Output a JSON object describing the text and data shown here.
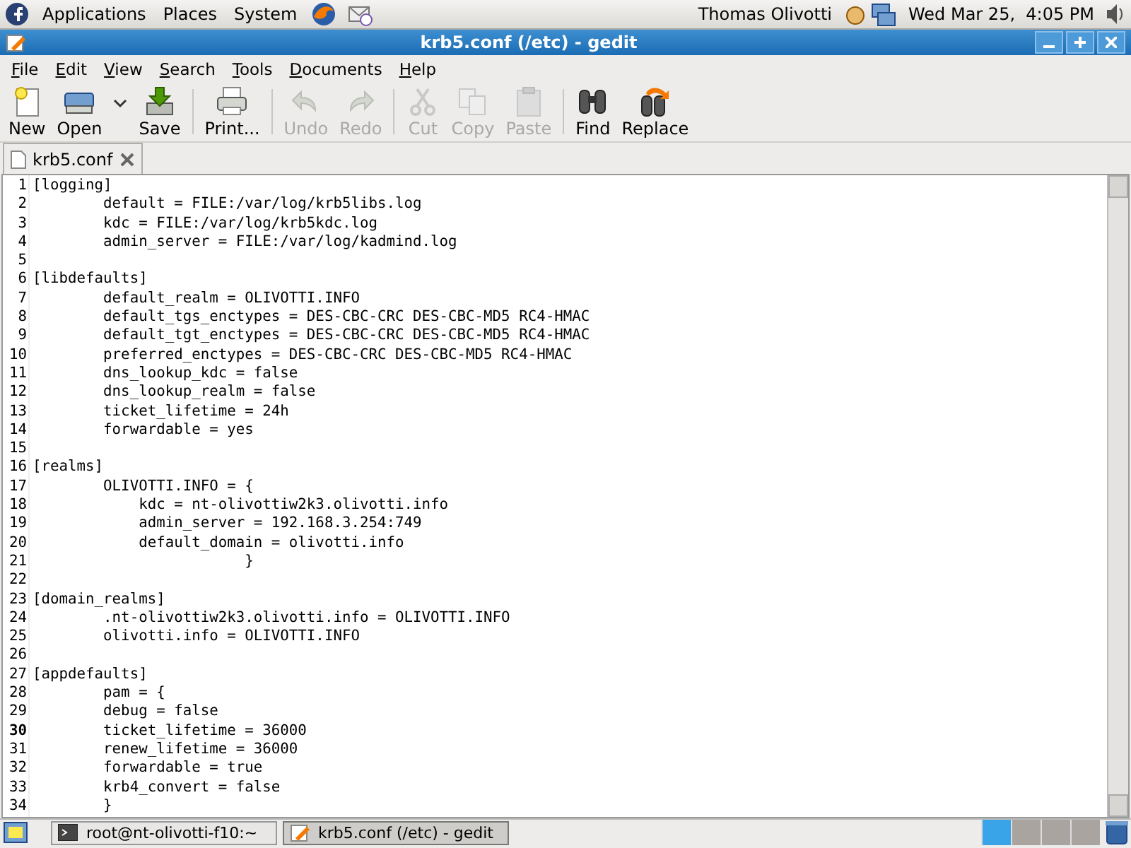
{
  "top_panel": {
    "menus": [
      "Applications",
      "Places",
      "System"
    ],
    "user": "Thomas Olivotti",
    "clock": "Wed Mar 25,  4:05 PM"
  },
  "window": {
    "title": "krb5.conf (/etc) - gedit"
  },
  "menubar": [
    {
      "label": "File"
    },
    {
      "label": "Edit"
    },
    {
      "label": "View"
    },
    {
      "label": "Search"
    },
    {
      "label": "Tools"
    },
    {
      "label": "Documents"
    },
    {
      "label": "Help"
    }
  ],
  "toolbar": [
    {
      "kind": "new",
      "label": "New",
      "disabled": false
    },
    {
      "kind": "open",
      "label": "Open",
      "disabled": false
    },
    {
      "kind": "save",
      "label": "Save",
      "disabled": false
    },
    {
      "kind": "separator"
    },
    {
      "kind": "print",
      "label": "Print...",
      "disabled": false
    },
    {
      "kind": "separator"
    },
    {
      "kind": "undo",
      "label": "Undo",
      "disabled": true
    },
    {
      "kind": "redo",
      "label": "Redo",
      "disabled": true
    },
    {
      "kind": "separator"
    },
    {
      "kind": "cut",
      "label": "Cut",
      "disabled": true
    },
    {
      "kind": "copy",
      "label": "Copy",
      "disabled": true
    },
    {
      "kind": "paste",
      "label": "Paste",
      "disabled": true
    },
    {
      "kind": "separator"
    },
    {
      "kind": "find",
      "label": "Find",
      "disabled": false
    },
    {
      "kind": "replace",
      "label": "Replace",
      "disabled": false
    }
  ],
  "tabs": [
    {
      "label": "krb5.conf",
      "selected": true
    }
  ],
  "editor": {
    "lines": [
      {
        "number": "1",
        "text": "[logging]",
        "current": false
      },
      {
        "number": "2",
        "text": "\tdefault = FILE:/var/log/krb5libs.log",
        "current": false
      },
      {
        "number": "3",
        "text": "\tkdc = FILE:/var/log/krb5kdc.log",
        "current": false
      },
      {
        "number": "4",
        "text": "\tadmin_server = FILE:/var/log/kadmind.log",
        "current": false
      },
      {
        "number": "5",
        "current": false
      },
      {
        "number": "6",
        "text": "[libdefaults]",
        "current": false
      },
      {
        "number": "7",
        "text": "\tdefault_realm = OLIVOTTI.INFO",
        "current": false
      },
      {
        "number": "8",
        "text": "\tdefault_tgs_enctypes = DES-CBC-CRC DES-CBC-MD5 RC4-HMAC",
        "current": false
      },
      {
        "number": "9",
        "text": "\tdefault_tgt_enctypes = DES-CBC-CRC DES-CBC-MD5 RC4-HMAC",
        "current": false
      },
      {
        "number": "10",
        "text": "\tpreferred_enctypes = DES-CBC-CRC DES-CBC-MD5 RC4-HMAC",
        "current": false
      },
      {
        "number": "11",
        "text": "\tdns_lookup_kdc = false",
        "current": false
      },
      {
        "number": "12",
        "text": "\tdns_lookup_realm = false",
        "current": false
      },
      {
        "number": "13",
        "text": "\tticket_lifetime = 24h",
        "current": false
      },
      {
        "number": "14",
        "text": "\tforwardable = yes",
        "current": false
      },
      {
        "number": "15",
        "current": false
      },
      {
        "number": "16",
        "text": "[realms]",
        "current": false
      },
      {
        "number": "17",
        "text": "\tOLIVOTTI.INFO = {",
        "current": false
      },
      {
        "number": "18",
        "text": "\t    kdc = nt-olivottiw2k3.olivotti.info",
        "current": false
      },
      {
        "number": "19",
        "text": "\t    admin_server = 192.168.3.254:749",
        "current": false
      },
      {
        "number": "20",
        "text": "\t    default_domain = olivotti.info",
        "current": false
      },
      {
        "number": "21",
        "text": "\t\t\t}",
        "current": false
      },
      {
        "number": "22",
        "current": false
      },
      {
        "number": "23",
        "text": "[domain_realms]",
        "current": false
      },
      {
        "number": "24",
        "text": "\t.nt-olivottiw2k3.olivotti.info = OLIVOTTI.INFO",
        "current": false
      },
      {
        "number": "25",
        "text": "\tolivotti.info = OLIVOTTI.INFO",
        "current": false
      },
      {
        "number": "26",
        "current": false
      },
      {
        "number": "27",
        "text": "[appdefaults]",
        "current": false
      },
      {
        "number": "28",
        "text": "\tpam = {",
        "current": false
      },
      {
        "number": "29",
        "text": "\tdebug = false",
        "current": false
      },
      {
        "number": "30",
        "text": "\tticket_lifetime = 36000",
        "current": true
      },
      {
        "number": "31",
        "text": "\trenew_lifetime = 36000",
        "current": false
      },
      {
        "number": "32",
        "text": "\tforwardable = true",
        "current": false
      },
      {
        "number": "33",
        "text": "\tkrb4_convert = false",
        "current": false
      },
      {
        "number": "34",
        "text": "\t}",
        "current": false
      }
    ]
  },
  "taskbar": {
    "tasks": [
      {
        "kind": "terminal",
        "label": "root@nt-olivotti-f10:~",
        "selected": false
      },
      {
        "kind": "editor",
        "label": "krb5.conf (/etc) - gedit",
        "selected": true
      }
    ],
    "workspaces": [
      {
        "selected": true
      },
      {
        "selected": false
      },
      {
        "selected": false
      },
      {
        "selected": false
      }
    ]
  }
}
